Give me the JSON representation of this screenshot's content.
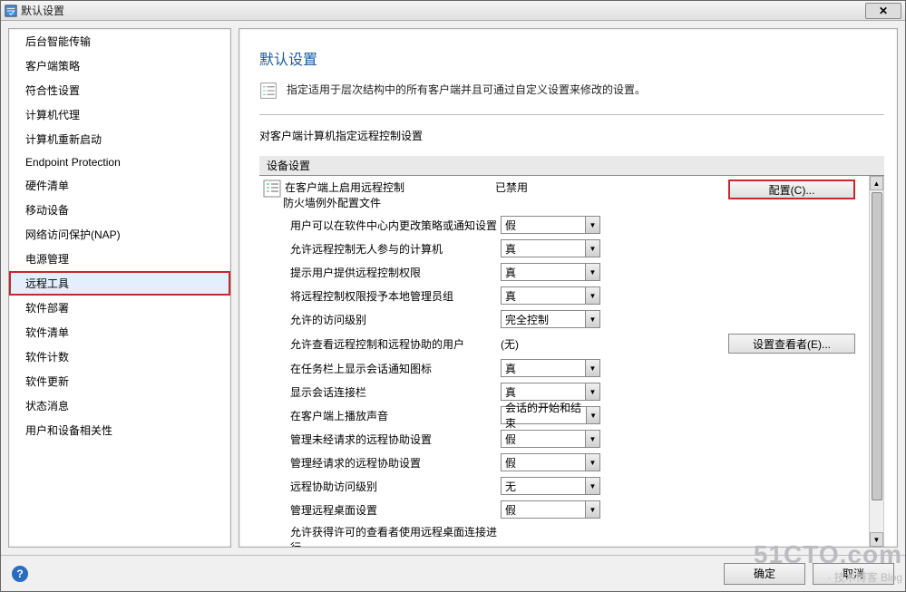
{
  "window": {
    "title": "默认设置"
  },
  "sidebar": {
    "items": [
      {
        "label": "后台智能传输"
      },
      {
        "label": "客户端策略"
      },
      {
        "label": "符合性设置"
      },
      {
        "label": "计算机代理"
      },
      {
        "label": "计算机重新启动"
      },
      {
        "label": "Endpoint Protection"
      },
      {
        "label": "硬件清单"
      },
      {
        "label": "移动设备"
      },
      {
        "label": "网络访问保护(NAP)"
      },
      {
        "label": "电源管理"
      },
      {
        "label": "远程工具",
        "selected": true
      },
      {
        "label": "软件部署"
      },
      {
        "label": "软件清单"
      },
      {
        "label": "软件计数"
      },
      {
        "label": "软件更新"
      },
      {
        "label": "状态消息"
      },
      {
        "label": "用户和设备相关性"
      }
    ]
  },
  "main": {
    "title": "默认设置",
    "description": "指定适用于层次结构中的所有客户端并且可通过自定义设置来修改的设置。",
    "section_label": "对客户端计算机指定远程控制设置",
    "group_header": "设备设置",
    "rows": {
      "r0": {
        "label": "在客户端上启用远程控制",
        "sub": "防火墙例外配置文件",
        "value": "已禁用",
        "action": "配置(C)..."
      },
      "r1": {
        "label": "用户可以在软件中心内更改策略或通知设置",
        "value": "假"
      },
      "r2": {
        "label": "允许远程控制无人参与的计算机",
        "value": "真"
      },
      "r3": {
        "label": "提示用户提供远程控制权限",
        "value": "真"
      },
      "r4": {
        "label": "将远程控制权限授予本地管理员组",
        "value": "真"
      },
      "r5": {
        "label": "允许的访问级别",
        "value": "完全控制"
      },
      "r6": {
        "label": "允许查看远程控制和远程协助的用户",
        "value": "(无)",
        "action": "设置查看者(E)..."
      },
      "r7": {
        "label": "在任务栏上显示会话通知图标",
        "value": "真"
      },
      "r8": {
        "label": "显示会话连接栏",
        "value": "真"
      },
      "r9": {
        "label": "在客户端上播放声音",
        "value": "会话的开始和结束"
      },
      "r10": {
        "label": "管理未经请求的远程协助设置",
        "value": "假"
      },
      "r11": {
        "label": "管理经请求的远程协助设置",
        "value": "假"
      },
      "r12": {
        "label": "远程协助访问级别",
        "value": "无"
      },
      "r13": {
        "label": "管理远程桌面设置",
        "value": "假"
      },
      "r14": {
        "label": "允许获得许可的查看者使用远程桌面连接进行"
      }
    }
  },
  "footer": {
    "ok": "确定",
    "cancel": "取消"
  },
  "watermark": {
    "big": "51CTO.com",
    "small": "· 技术博客   Blog"
  }
}
